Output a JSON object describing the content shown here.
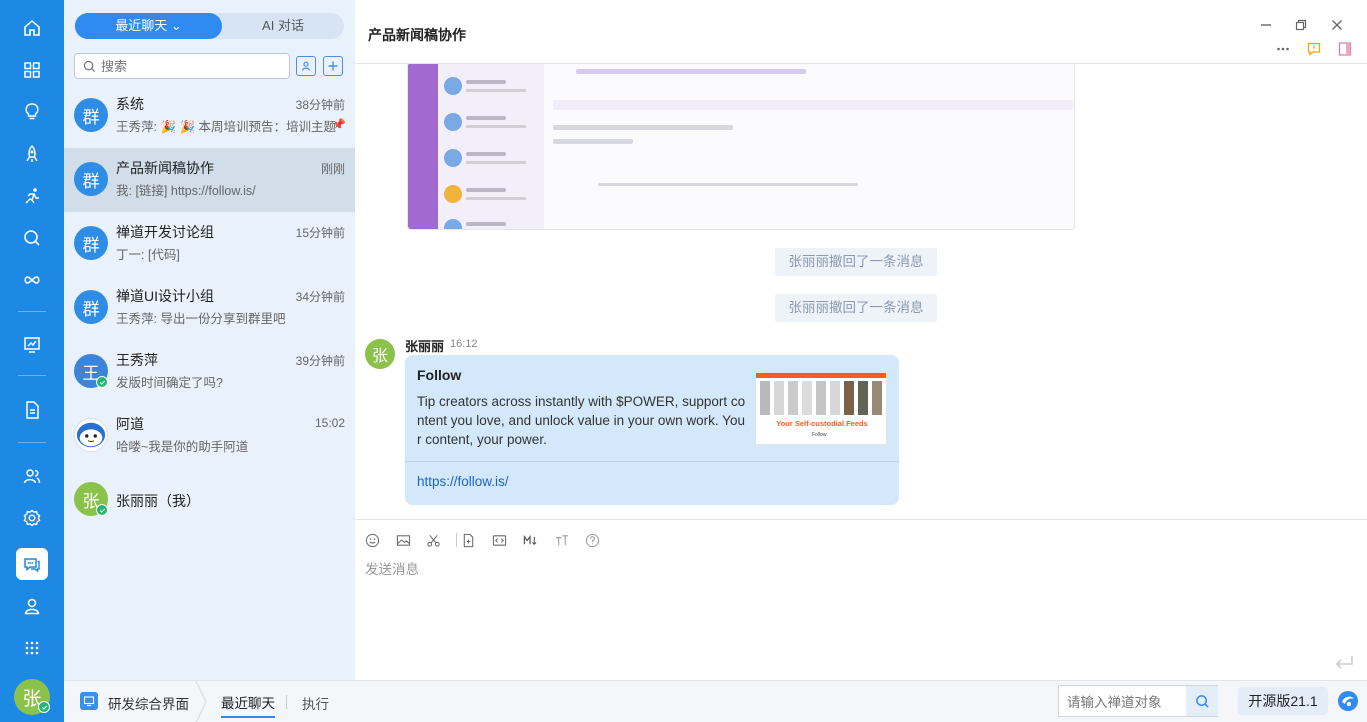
{
  "colors": {
    "rail": "#1e88e5",
    "accent": "#2f8bf0",
    "list_bg": "#e9f1fb",
    "online": "#22b573",
    "card": "#d4e8fb"
  },
  "rail": {
    "icons": [
      "home-icon",
      "grid-icon",
      "lightbulb-icon",
      "rocket-icon",
      "run-icon",
      "search-icon",
      "infinity-icon",
      "board-icon",
      "document-icon",
      "team-icon",
      "gear-icon",
      "chat-icon",
      "user-icon",
      "apps-icon"
    ],
    "avatar": "张"
  },
  "list": {
    "tabs": {
      "recent": "最近聊天",
      "ai": "AI 对话"
    },
    "search_placeholder": "搜索",
    "chats": [
      {
        "avatar": "群",
        "name": "系统",
        "time": "38分钟前",
        "preview": "王秀萍: 🎉 🎉 本周培训预告：培训主题",
        "pinned": "📌"
      },
      {
        "avatar": "群",
        "name": "产品新闻稿协作",
        "time": "刚刚",
        "preview": "我: [链接] https://follow.is/"
      },
      {
        "avatar": "群",
        "name": "禅道开发讨论组",
        "time": "15分钟前",
        "preview": "丁一: [代码]"
      },
      {
        "avatar": "群",
        "name": "禅道UI设计小组",
        "time": "34分钟前",
        "preview": "王秀萍: 导出一份分享到群里吧"
      },
      {
        "avatar": "王",
        "name": "王秀萍",
        "time": "39分钟前",
        "preview": "发版时间确定了吗?"
      },
      {
        "avatar": "",
        "name": "阿道",
        "time": "15:02",
        "preview": "哈喽~我是你的助手阿道"
      },
      {
        "avatar": "张",
        "name": "张丽丽（我）",
        "time": "",
        "preview": ""
      }
    ]
  },
  "chat": {
    "title": "产品新闻稿协作",
    "recalled": [
      "张丽丽撤回了一条消息",
      "张丽丽撤回了一条消息"
    ],
    "message": {
      "avatar": "张",
      "sender": "张丽丽",
      "time": "16:12",
      "card_title": "Follow",
      "card_desc": "Tip creators across instantly with $POWER, support content you love, and unlock value in your own work. Your content, your power.",
      "card_image_caption": "Your Self-custodial Feeds",
      "card_image_sub": "Follow",
      "link": "https://follow.is/"
    },
    "composer_placeholder": "发送消息"
  },
  "footer": {
    "app": "研发综合界面",
    "tab_active": "最近聊天",
    "tab_other": "执行",
    "search_placeholder": "请输入禅道对象",
    "version": "开源版21.1"
  }
}
